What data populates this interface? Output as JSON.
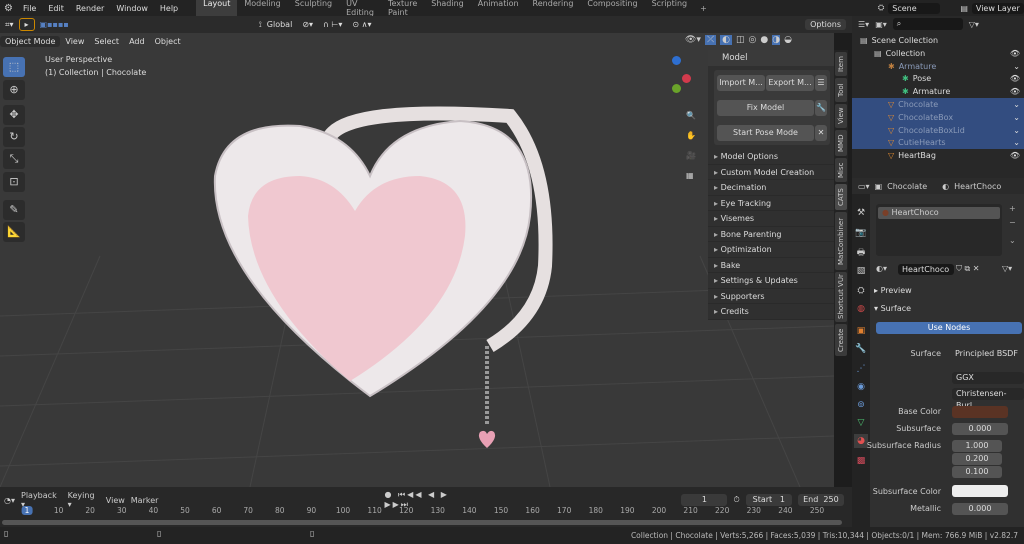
{
  "menu": [
    "File",
    "Edit",
    "Render",
    "Window",
    "Help"
  ],
  "workspaces": [
    "Layout",
    "Modeling",
    "Sculpting",
    "UV Editing",
    "Texture Paint",
    "Shading",
    "Animation",
    "Rendering",
    "Compositing",
    "Scripting"
  ],
  "add_workspace": "+",
  "scene": "Scene",
  "view_layer": "View Layer",
  "header": {
    "orientation": "Global",
    "options": "Options",
    "mode": "Object Mode",
    "view": "View",
    "select": "Select",
    "add": "Add",
    "object": "Object"
  },
  "viewport": {
    "perspective": "User Perspective",
    "collection_info": "(1) Collection | Chocolate"
  },
  "npanel": {
    "title": "Model",
    "import": "Import M...",
    "export": "Export M...",
    "fix": "Fix Model",
    "pose": "Start Pose Mode",
    "sections": [
      "Model Options",
      "Custom Model Creation",
      "Decimation",
      "Eye Tracking",
      "Visemes",
      "Bone Parenting",
      "Optimization",
      "Bake",
      "Settings & Updates",
      "Supporters",
      "Credits"
    ]
  },
  "vtabs": [
    "Item",
    "Tool",
    "View",
    "MMD",
    "Misc",
    "CATS",
    "MatCombiner",
    "Shortcut VUr",
    "Create"
  ],
  "outliner": {
    "items": [
      {
        "label": "Scene Collection",
        "indent": 0,
        "sel": false
      },
      {
        "label": "Collection",
        "indent": 1,
        "sel": false
      },
      {
        "label": "Armature",
        "indent": 2,
        "sel": false
      },
      {
        "label": "Pose",
        "indent": 3,
        "sel": false
      },
      {
        "label": "Armature",
        "indent": 3,
        "sel": false
      },
      {
        "label": "Chocolate",
        "indent": 2,
        "sel": true
      },
      {
        "label": "ChocolateBox",
        "indent": 2,
        "sel": true
      },
      {
        "label": "ChocolateBoxLid",
        "indent": 2,
        "sel": true
      },
      {
        "label": "CutieHearts",
        "indent": 2,
        "sel": true
      },
      {
        "label": "HeartBag",
        "indent": 2,
        "sel": false
      }
    ]
  },
  "properties": {
    "object": "Chocolate",
    "material": "HeartChoco",
    "slot": "HeartChoco",
    "mat_name": "HeartChoco",
    "preview": "Preview",
    "surface_section": "Surface",
    "use_nodes": "Use Nodes",
    "surface_label": "Surface",
    "surface_value": "Principled BSDF",
    "distribution": "GGX",
    "subsurface_method": "Christensen-Burl...",
    "base_color_label": "Base Color",
    "base_color": "#5a3324",
    "subsurface_label": "Subsurface",
    "subsurface": "0.000",
    "radius_label": "Subsurface Radius",
    "radius": [
      "1.000",
      "0.200",
      "0.100"
    ],
    "subsurface_color_label": "Subsurface Color",
    "subsurface_color": "#eeeeee",
    "metallic_label": "Metallic",
    "metallic": "0.000"
  },
  "timeline": {
    "playback": "Playback",
    "keying": "Keying",
    "view": "View",
    "marker": "Marker",
    "current": "1",
    "start_label": "Start",
    "start": "1",
    "end_label": "End",
    "end": "250",
    "ticks": [
      "1",
      "10",
      "20",
      "30",
      "40",
      "50",
      "60",
      "70",
      "80",
      "90",
      "100",
      "110",
      "120",
      "130",
      "140",
      "150",
      "160",
      "170",
      "180",
      "190",
      "200",
      "210",
      "220",
      "230",
      "240",
      "250"
    ]
  },
  "status": "Collection | Chocolate | Verts:5,266 | Faces:5,039 | Tris:10,344 | Objects:0/1 | Mem: 766.9 MiB | v2.82.7"
}
